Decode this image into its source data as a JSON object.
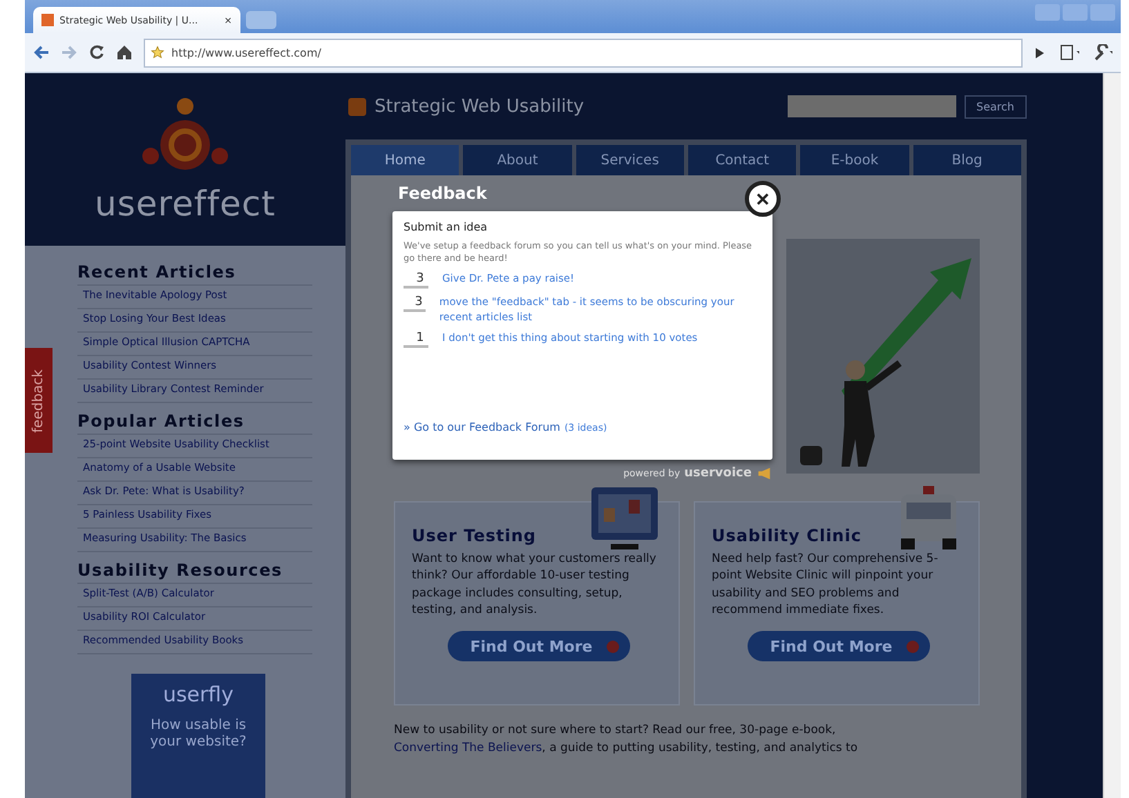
{
  "browser": {
    "tab_title": "Strategic Web Usability | U...",
    "tab_close": "×",
    "url": "http://www.usereffect.com/"
  },
  "site": {
    "logo_text": "usereffect",
    "tagline": "Strategic Web Usability",
    "search_button": "Search",
    "nav": [
      {
        "label": "Home",
        "selected": true
      },
      {
        "label": "About",
        "selected": false
      },
      {
        "label": "Services",
        "selected": false
      },
      {
        "label": "Contact",
        "selected": false
      },
      {
        "label": "E-book",
        "selected": false
      },
      {
        "label": "Blog",
        "selected": false
      }
    ]
  },
  "feedback_tab": "feedback",
  "sidebar": [
    {
      "heading": "Recent Articles",
      "links": [
        "The Inevitable Apology Post",
        "Stop Losing Your Best Ideas",
        "Simple Optical Illusion CAPTCHA",
        "Usability Contest Winners",
        "Usability Library Contest Reminder"
      ]
    },
    {
      "heading": "Popular Articles",
      "links": [
        "25-point Website Usability Checklist",
        "Anatomy of a Usable Website",
        "Ask Dr. Pete: What is Usability?",
        "5 Painless Usability Fixes",
        "Measuring Usability: The Basics"
      ]
    },
    {
      "heading": "Usability Resources",
      "links": [
        "Split-Test (A/B) Calculator",
        "Usability ROI Calculator",
        "Recommended Usability Books"
      ]
    }
  ],
  "ad": {
    "brand": "userfly",
    "text": "How usable is your website?"
  },
  "feedback": {
    "title": "Feedback",
    "close": "✕",
    "heading": "Submit an idea",
    "intro": "We've setup a feedback forum so you can tell us what's on your mind. Please go there and be heard!",
    "ideas": [
      {
        "votes": "3",
        "text": "Give Dr. Pete a pay raise!"
      },
      {
        "votes": "3",
        "text": "move the \"feedback\" tab - it seems to be obscuring your recent articles list"
      },
      {
        "votes": "1",
        "text": "I don't get this thing about starting with 10 votes"
      }
    ],
    "forum_link": "» Go to our Feedback Forum",
    "forum_count": "(3 ideas)",
    "powered_by": "powered by",
    "vendor": "uservoice"
  },
  "boxes": [
    {
      "kind": "monitor",
      "title": "User Testing",
      "text": "Want to know what your customers really think? Our affordable 10-user testing package includes consulting, setup, testing, and analysis.",
      "button": "Find Out More"
    },
    {
      "kind": "ambulance",
      "title": "Usability Clinic",
      "text": "Need help fast? Our comprehensive 5-point Website Clinic will pinpoint your usability and SEO problems and recommend immediate fixes.",
      "button": "Find Out More"
    }
  ],
  "intro": {
    "before": "New to usability or not sure where to start? Read our free, 30-page e-book, ",
    "link": "Converting The Believers",
    "after": ", a guide to putting usability, testing, and analytics to"
  }
}
